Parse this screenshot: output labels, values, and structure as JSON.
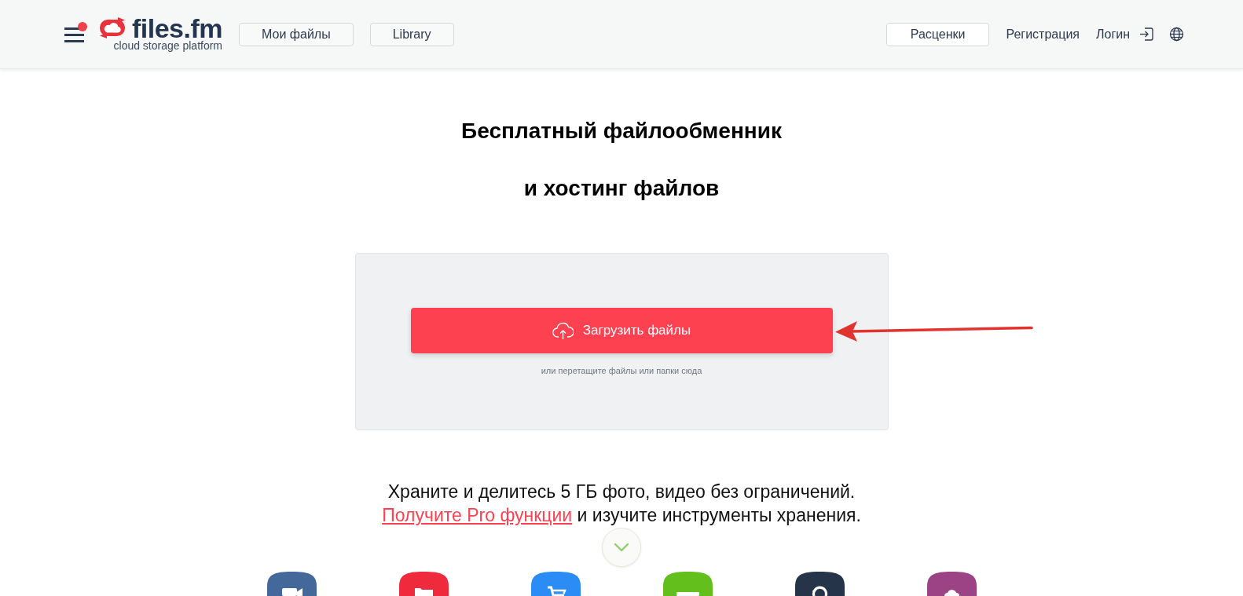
{
  "menu": {
    "notification": true
  },
  "logo": {
    "name": "files.fm",
    "tagline": "cloud storage platform"
  },
  "nav_left": [
    "Мои файлы",
    "Library"
  ],
  "nav_right": [
    {
      "label": "Расценки",
      "kind": "button"
    },
    {
      "label": "Регистрация",
      "kind": "link"
    },
    {
      "label": "Логин",
      "kind": "login"
    }
  ],
  "headline": [
    "Бесплатный файлообменник",
    "и хостинг файлов"
  ],
  "upload": {
    "button": "Загрузить файлы",
    "hint": "или перетащите файлы или папки сюда"
  },
  "promo": {
    "text_1": "Храните и делитесь 5 ГБ фото, видео без ограничений.",
    "link": "Получите Pro функции",
    "text_2": "и изучите инструменты хранения."
  }
}
